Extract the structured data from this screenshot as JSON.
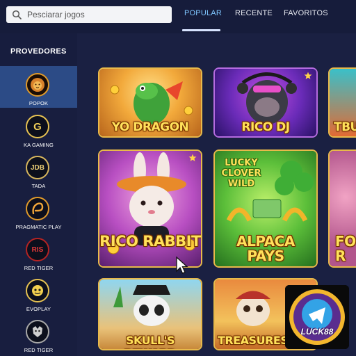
{
  "search": {
    "placeholder": "Pesciarar jogos"
  },
  "tabs": [
    {
      "label": "POPULAR",
      "active": true
    },
    {
      "label": "RECENTE",
      "active": false
    },
    {
      "label": "FAVORITOS",
      "active": false
    }
  ],
  "sidebar": {
    "title": "PROVEDORES",
    "items": [
      {
        "label": "POPOK",
        "icon": "lion-icon",
        "active": true
      },
      {
        "label": "KA GAMING",
        "icon": "ka-gaming-logo-icon",
        "logo_text": "G"
      },
      {
        "label": "TADA",
        "icon": "jdb-logo-icon",
        "logo_text": "JDB"
      },
      {
        "label": "PRAGMATIC PLAY",
        "icon": "pragmatic-logo-icon"
      },
      {
        "label": "RED TIGER",
        "icon": "red-tiger-logo-icon",
        "logo_text": "RIS"
      },
      {
        "label": "EVOPLAY",
        "icon": "evoplay-logo-icon"
      },
      {
        "label": "RED TIGER",
        "icon": "red-tiger-logo-icon"
      }
    ]
  },
  "games": [
    {
      "title": "YO DRAGON",
      "favorite": false
    },
    {
      "title": "RICO DJ",
      "favorite": true
    },
    {
      "title": "TBU",
      "favorite": false
    },
    {
      "title": "RICO RABBIT",
      "favorite": true
    },
    {
      "title": "ALPACA\nPAYS",
      "subtitle": "LUCKY\nCLOVER\nWILD",
      "favorite": false
    },
    {
      "title": "FO R",
      "favorite": false
    },
    {
      "title": "SKULL'S REWARD",
      "favorite": false
    },
    {
      "title": "TREASURES O",
      "favorite": false
    }
  ],
  "badge": {
    "text": "LUCK88"
  },
  "colors": {
    "background": "#171d3e",
    "active_tab": "#7fc6ff",
    "active_provider": "#2c4b86",
    "card_border": "#e0b24d",
    "title_yellow": "#ffe15a"
  }
}
